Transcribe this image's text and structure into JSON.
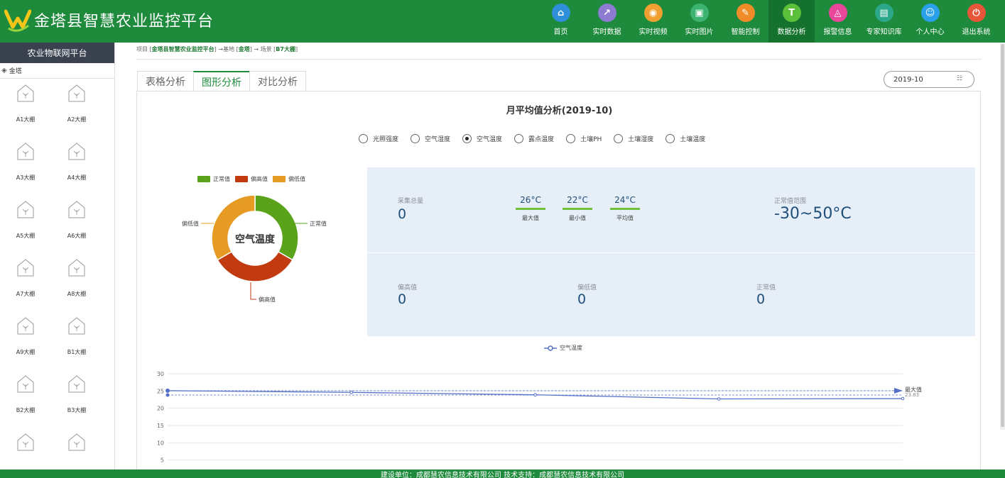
{
  "app": {
    "title": "金塔县智慧农业监控平台"
  },
  "nav": [
    {
      "label": "首页",
      "icon": "home-icon",
      "color": "#2f8fd8",
      "glyph": "⌂"
    },
    {
      "label": "实时数据",
      "icon": "chart-icon",
      "color": "#8d7bd1",
      "glyph": "↗"
    },
    {
      "label": "实时视频",
      "icon": "video-icon",
      "color": "#f0a030",
      "glyph": "◉"
    },
    {
      "label": "实时图片",
      "icon": "image-icon",
      "color": "#3cb371",
      "glyph": "▣"
    },
    {
      "label": "智能控制",
      "icon": "control-icon",
      "color": "#f08c28",
      "glyph": "✎"
    },
    {
      "label": "数据分析",
      "icon": "analysis-icon",
      "color": "#5cbf3a",
      "glyph": "T"
    },
    {
      "label": "报警信息",
      "icon": "alarm-icon",
      "color": "#e8479a",
      "glyph": "◬"
    },
    {
      "label": "专家知识库",
      "icon": "book-icon",
      "color": "#2aa889",
      "glyph": "▤"
    },
    {
      "label": "个人中心",
      "icon": "user-icon",
      "color": "#2aa0e8",
      "glyph": "☺"
    },
    {
      "label": "退出系统",
      "icon": "exit-icon",
      "color": "#e8563a",
      "glyph": "⏻"
    }
  ],
  "sidebar": {
    "title": "农业物联网平台",
    "tree_root": "金塔",
    "greenhouses": [
      "A1大棚",
      "A2大棚",
      "A3大棚",
      "A4大棚",
      "A5大棚",
      "A6大棚",
      "A7大棚",
      "A8大棚",
      "A9大棚",
      "B1大棚",
      "B2大棚",
      "B3大棚",
      "",
      ""
    ]
  },
  "breadcrumb": {
    "p1": "项目 [",
    "project": "金塔县智慧农业监控平台",
    "p2": "] →基地 [",
    "base": "金塔",
    "p3": "] → 场景 [",
    "scene": "B7大棚",
    "p4": "]"
  },
  "tabs": [
    "表格分析",
    "图形分析",
    "对比分析"
  ],
  "date": "2019-10",
  "panel": {
    "title": "月平均值分析(2019-10)",
    "radios": [
      "光照强度",
      "空气湿度",
      "空气温度",
      "露点温度",
      "土壤PH",
      "土壤湿度",
      "土壤温度"
    ]
  },
  "donut": {
    "center_label": "空气温度",
    "legend": [
      "正常值",
      "偏高值",
      "偏低值"
    ],
    "labels": {
      "normal": "正常值",
      "high": "偏高值",
      "low": "偏低值"
    },
    "colors": {
      "normal": "#5aa21a",
      "high": "#c23a10",
      "low": "#e69c24"
    }
  },
  "stats": {
    "total_label": "采集总量",
    "total_value": "0",
    "max_value": "26°C",
    "max_label": "最大值",
    "min_value": "22°C",
    "min_label": "最小值",
    "avg_value": "24°C",
    "avg_label": "平均值",
    "range_label": "正常值范围",
    "range_value": "-30~50°C",
    "high_label": "偏高值",
    "high_value": "0",
    "low_label": "偏低值",
    "low_value": "0",
    "normal_label": "正常值",
    "normal_value": "0"
  },
  "line_legend": "空气温度",
  "footer": "建设单位：成都慧农信息技术有限公司    技术支持：成都慧农信息技术有限公司",
  "chart_data": [
    {
      "type": "pie",
      "categories": [
        "正常值",
        "偏高值",
        "偏低值"
      ],
      "values": [
        1,
        1,
        1
      ],
      "title": "空气温度"
    },
    {
      "type": "line",
      "series": [
        {
          "name": "空气温度",
          "values": [
            25.1,
            24.6,
            23.9,
            22.7,
            22.8
          ]
        }
      ],
      "y_ticks": [
        5,
        10,
        15,
        20,
        25,
        30
      ],
      "ylim": [
        0,
        30
      ],
      "annotations": [
        "最大值",
        "23.83"
      ],
      "grid": true
    }
  ]
}
